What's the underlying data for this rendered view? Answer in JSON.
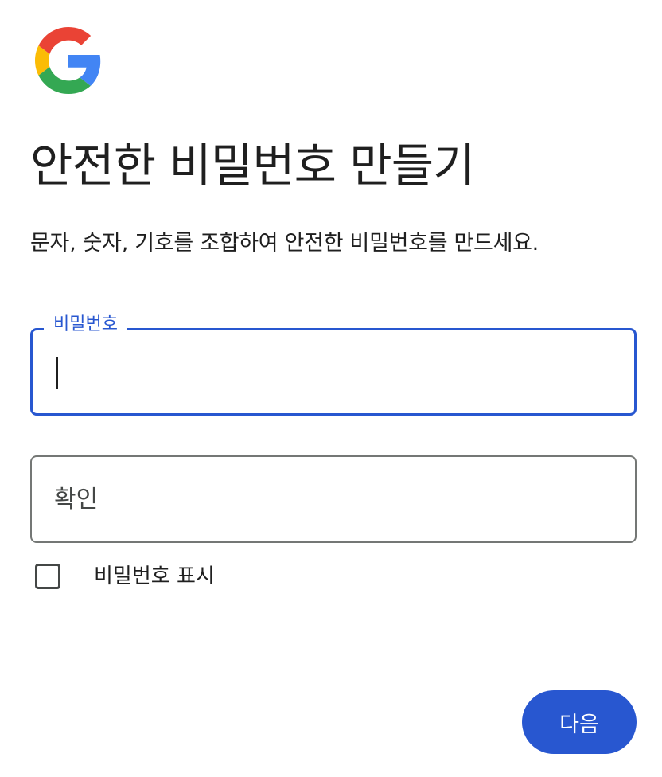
{
  "brand": {
    "logo_icon": "google-g-logo",
    "colors": {
      "red": "#EA4335",
      "yellow": "#FBBC05",
      "green": "#34A853",
      "blue": "#4285F4"
    }
  },
  "header": {
    "title": "안전한 비밀번호 만들기",
    "subtitle": "문자, 숫자, 기호를 조합하여 안전한 비밀번호를 만드세요."
  },
  "form": {
    "password": {
      "label": "비밀번호",
      "value": "",
      "state": "focused"
    },
    "confirm": {
      "placeholder": "확인",
      "value": ""
    },
    "show_password": {
      "label": "비밀번호 표시",
      "checked": false
    }
  },
  "actions": {
    "next_label": "다음"
  },
  "theme": {
    "accent": "#2857D0",
    "text": "#1F1F1F",
    "border": "#747775"
  }
}
